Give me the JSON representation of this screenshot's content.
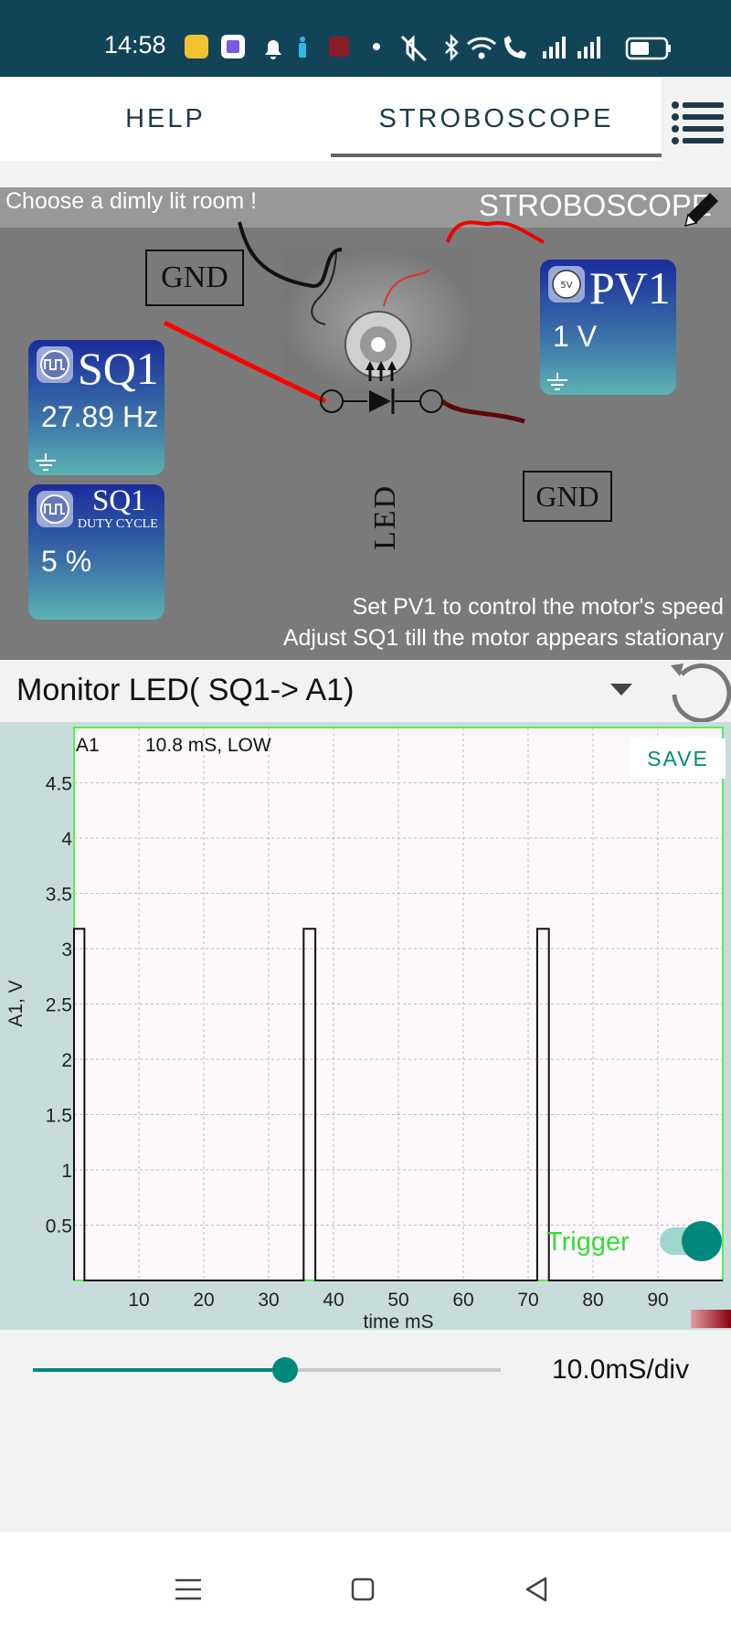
{
  "status_bar": {
    "time": "14:58",
    "icons": [
      "maps-icon",
      "gallery-icon",
      "notification-bell-icon",
      "person-icon",
      "app-icon",
      "dot-icon",
      "mute-icon",
      "bluetooth-icon",
      "wifi-icon",
      "wifi-calling-icon",
      "signal-icon",
      "signal-icon",
      "battery-icon"
    ]
  },
  "tabs": [
    {
      "label": "HELP",
      "active": false
    },
    {
      "label": "STROBOSCOPE",
      "active": true
    }
  ],
  "experiment": {
    "hint_top": "Choose a dimly lit room !",
    "title": "STROBOSCOPE",
    "gnd_top": "GND",
    "gnd_right": "GND",
    "pv1": {
      "title": "PV1",
      "value": "1 V"
    },
    "sq1": {
      "title": "SQ1",
      "value": "27.89 Hz"
    },
    "sq1_duty": {
      "title": "SQ1",
      "subtitle": "DUTY CYCLE",
      "value": "5 %"
    },
    "led_label": "LED",
    "instructions": [
      "Set PV1 to control the motor's speed",
      "Adjust SQ1 till the motor appears stationary"
    ]
  },
  "monitor": {
    "selected": "Monitor LED( SQ1-> A1)"
  },
  "plot": {
    "legend_channel": "A1",
    "legend_readout": "10.8 mS, LOW",
    "save_label": "SAVE",
    "trigger_label": "Trigger",
    "trigger_on": true
  },
  "timebase": {
    "label": "10.0mS/div",
    "slider_fraction": 0.54
  },
  "colors": {
    "accent": "#00897b",
    "plot_green": "#33dd33",
    "status_bar": "#124458"
  },
  "chart_data": {
    "type": "line",
    "title": "",
    "xlabel": "time mS",
    "ylabel": "A1, V",
    "xlim": [
      0,
      100
    ],
    "ylim": [
      0,
      5
    ],
    "x_ticks": [
      10,
      20,
      30,
      40,
      50,
      60,
      70,
      80,
      90
    ],
    "y_ticks": [
      0.5,
      1,
      1.5,
      2,
      2.5,
      3,
      3.5,
      4,
      4.5
    ],
    "grid": true,
    "series": [
      {
        "name": "A1",
        "x": [
          0,
          0,
          1.6,
          1.6,
          35.4,
          35.4,
          37.2,
          37.2,
          71.4,
          71.4,
          73.2,
          73.2,
          100
        ],
        "y": [
          0,
          3.18,
          3.18,
          0,
          0,
          3.18,
          3.18,
          0,
          0,
          3.18,
          3.18,
          0,
          0
        ]
      }
    ]
  }
}
